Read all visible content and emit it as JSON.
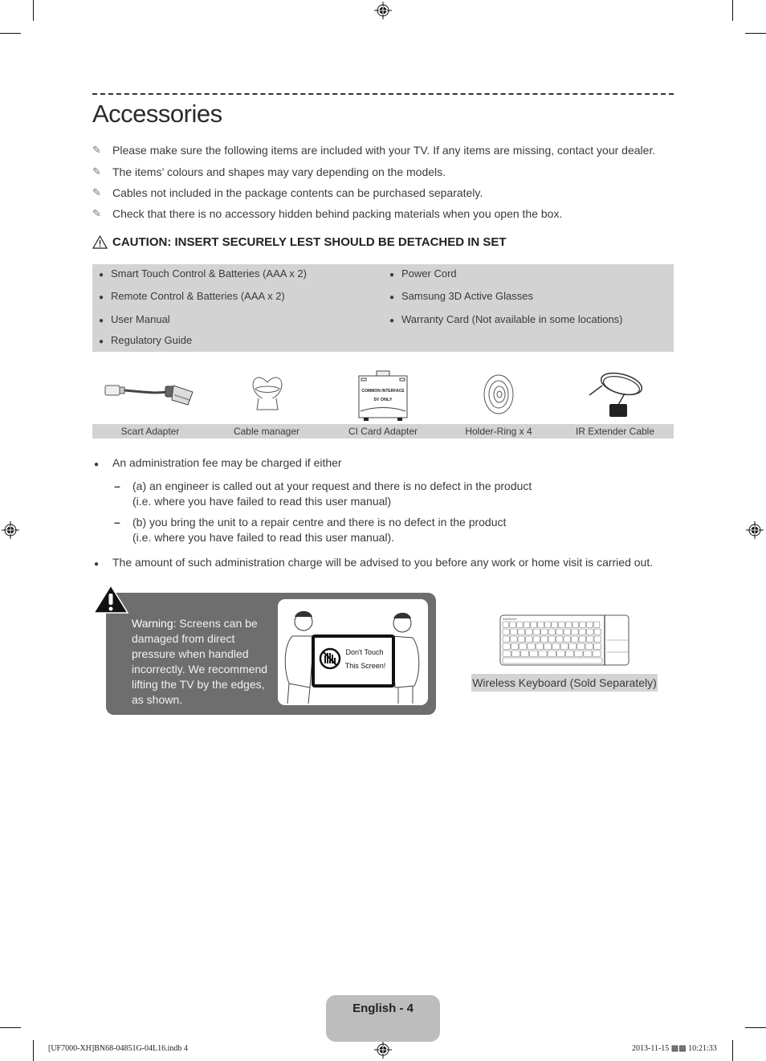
{
  "page": {
    "title": "Accessories",
    "notes": [
      "Please make sure the following items are included with your TV. If any items are missing, contact your dealer.",
      "The items’ colours and shapes may vary depending on the models.",
      "Cables not included in the package contents can be purchased separately.",
      "Check that there is no accessory hidden behind packing materials when you open the box."
    ],
    "note_icon": "pencil-note-icon",
    "caution": {
      "icon": "warning-triangle-icon",
      "text": "CAUTION: INSERT SECURELY LEST SHOULD BE DETACHED IN SET"
    },
    "accessory_list": {
      "left": [
        "Smart Touch Control & Batteries (AAA x 2)",
        "Remote Control & Batteries (AAA x 2)",
        "User Manual",
        "Regulatory Guide"
      ],
      "right": [
        "Power Cord",
        "Samsung 3D Active Glasses",
        "Warranty Card (Not available in some locations)"
      ]
    },
    "accessory_pictures": [
      {
        "caption": "Scart Adapter",
        "icon": "scart-adapter-icon"
      },
      {
        "caption": "Cable manager",
        "icon": "cable-manager-icon"
      },
      {
        "caption": "CI Card Adapter",
        "icon": "ci-card-adapter-icon",
        "label_line1": "COMMON INTERFACE",
        "label_line2": "5V ONLY"
      },
      {
        "caption": "Holder-Ring x 4",
        "icon": "holder-ring-icon"
      },
      {
        "caption": "IR Extender Cable",
        "icon": "ir-extender-cable-icon"
      }
    ],
    "admin_fee": {
      "bullet1": "An administration fee may be charged if either",
      "sub_a_line1": "(a) an engineer is called out at your request and there is no defect in the product",
      "sub_a_line2": "(i.e. where you have failed to read this user manual)",
      "sub_b_line1": "(b) you bring the unit to a repair centre and there is no defect in the product",
      "sub_b_line2": "(i.e. where you have failed to read this user manual).",
      "bullet2": "The amount of such administration charge will be advised to you before any work or home visit is carried out."
    },
    "warning": {
      "label": "Warning",
      "text": ": Screens can be damaged from direct pressure when handled incorrectly. We recommend lifting the TV by the edges, as shown.",
      "sign_line1": "Don't Touch",
      "sign_line2": "This Screen!"
    },
    "keyboard": {
      "caption": "Wireless Keyboard (Sold Separately)",
      "brand": "SAMSUNG"
    },
    "page_tab": "English - 4",
    "slug_left": "[UF7000-XH]BN68-04851G-04L16.indb   4",
    "slug_right": "2013-11-15   ▩▩ 10:21:33"
  }
}
